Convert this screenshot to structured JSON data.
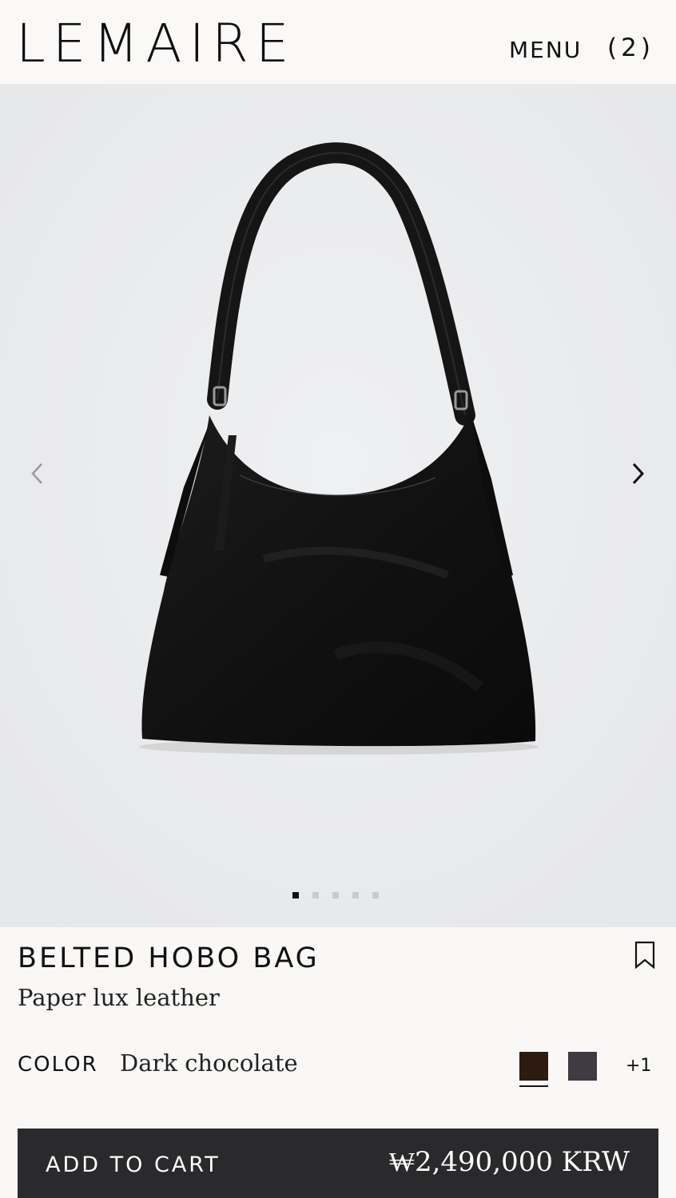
{
  "header": {
    "logo": "LEMAIRE",
    "menu_label": "MENU",
    "cart_count": "(2)"
  },
  "gallery": {
    "image_count": 5,
    "active_index": 0,
    "prev_icon": "chevron-left-icon",
    "next_icon": "chevron-right-icon"
  },
  "product": {
    "name": "BELTED HOBO BAG",
    "material": "Paper lux leather",
    "color_label": "COLOR",
    "color_value": "Dark chocolate",
    "swatches": [
      {
        "name": "Dark chocolate",
        "color": "#2b1b10",
        "selected": true
      },
      {
        "name": "Dark grey",
        "color": "#3e3b43",
        "selected": false
      }
    ],
    "more_colors": "+1"
  },
  "cart_bar": {
    "label": "ADD TO CART",
    "price": "₩2,490,000 KRW"
  },
  "colors": {
    "background": "#f9f8f6",
    "gallery_bg": "#eaebed",
    "button_bg": "#2a292b"
  }
}
